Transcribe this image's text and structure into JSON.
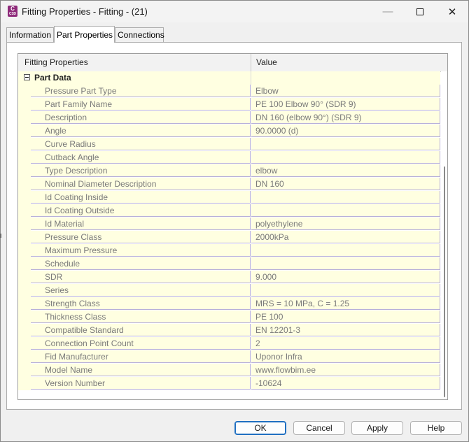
{
  "window": {
    "title": "Fitting Properties - Fitting - (21)",
    "app_icon": {
      "letter": "C",
      "sub": "C3D"
    },
    "controls": {
      "minimize": "—",
      "maximize_icon": "square",
      "close": "✕"
    }
  },
  "tabs": [
    {
      "label": "Information",
      "active": false
    },
    {
      "label": "Part Properties",
      "active": true
    },
    {
      "label": "Connections",
      "active": false
    }
  ],
  "grid": {
    "columns": [
      "Fitting Properties",
      "Value"
    ],
    "section": {
      "label": "Part Data",
      "expanded": true
    },
    "rows": [
      {
        "name": "Pressure Part Type",
        "value": "Elbow"
      },
      {
        "name": "Part Family Name",
        "value": "PE 100 Elbow 90° (SDR 9)"
      },
      {
        "name": "Description",
        "value": "DN 160 (elbow 90°) (SDR 9)"
      },
      {
        "name": "Angle",
        "value": "90.0000 (d)"
      },
      {
        "name": "Curve Radius",
        "value": ""
      },
      {
        "name": "Cutback Angle",
        "value": ""
      },
      {
        "name": "Type Description",
        "value": "elbow"
      },
      {
        "name": "Nominal Diameter Description",
        "value": "DN 160"
      },
      {
        "name": "Id Coating Inside",
        "value": ""
      },
      {
        "name": "Id Coating Outside",
        "value": ""
      },
      {
        "name": "Id Material",
        "value": "polyethylene"
      },
      {
        "name": "Pressure Class",
        "value": "2000kPa"
      },
      {
        "name": "Maximum Pressure",
        "value": ""
      },
      {
        "name": "Schedule",
        "value": ""
      },
      {
        "name": "SDR",
        "value": "9.000"
      },
      {
        "name": "Series",
        "value": ""
      },
      {
        "name": "Strength Class",
        "value": "MRS = 10 MPa, C = 1.25"
      },
      {
        "name": "Thickness Class",
        "value": "PE 100"
      },
      {
        "name": "Compatible Standard",
        "value": "EN 12201-3"
      },
      {
        "name": "Connection Point Count",
        "value": "2"
      },
      {
        "name": "Fid Manufacturer",
        "value": "Uponor Infra"
      },
      {
        "name": "Model Name",
        "value": "www.flowbim.ee"
      },
      {
        "name": "Version Number",
        "value": "-10624"
      }
    ]
  },
  "buttons": {
    "ok": "OK",
    "cancel": "Cancel",
    "apply": "Apply",
    "help": "Help"
  },
  "colors": {
    "row_background": "#ffffe1",
    "grid_line": "#b7b0d9",
    "default_button_border": "#1f6fc1",
    "app_icon": "#8e2a7a"
  }
}
